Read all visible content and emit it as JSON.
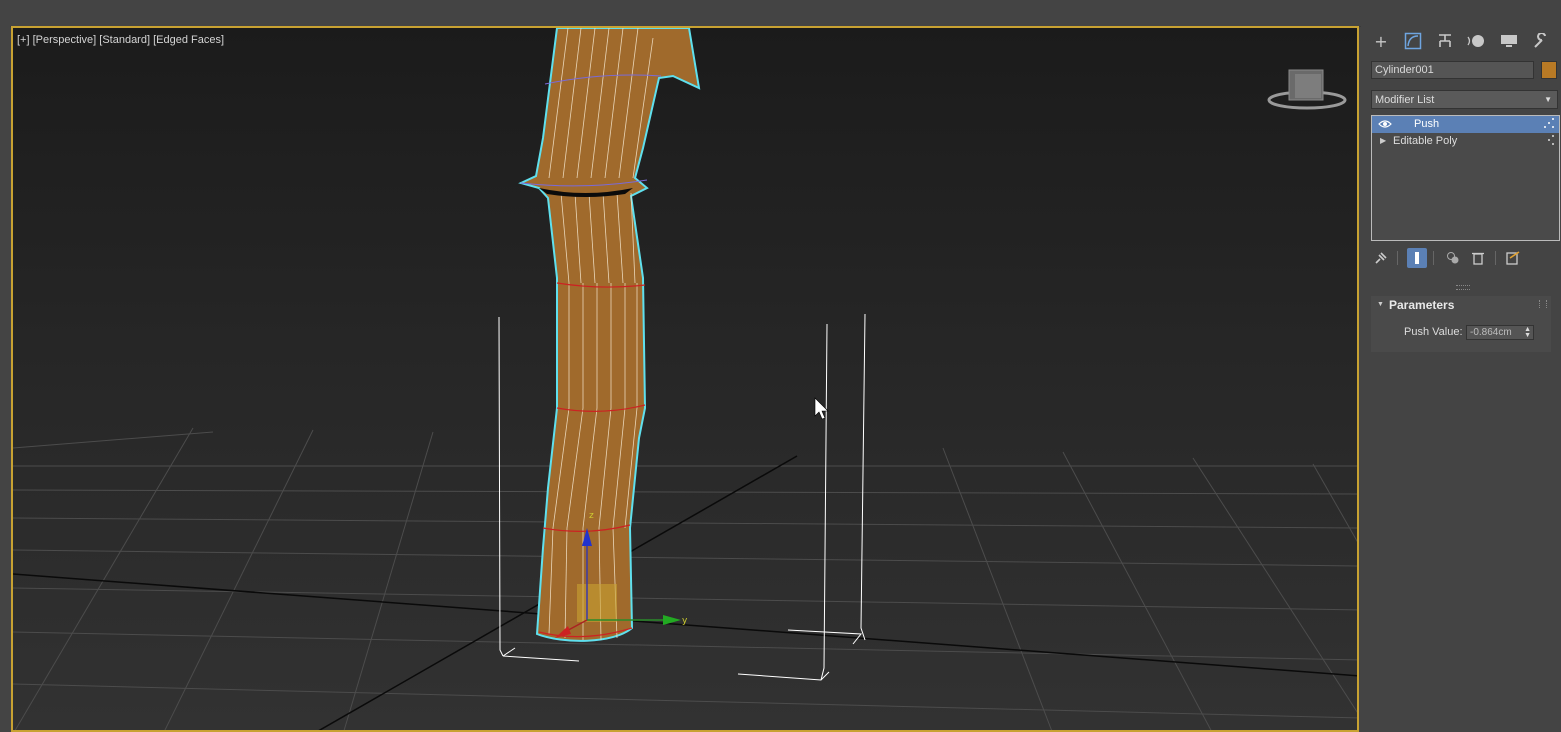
{
  "viewport": {
    "labels": [
      "[+]",
      "[Perspective]",
      "[Standard]",
      "[Edged Faces]"
    ],
    "gizmo_axes": {
      "x": "x",
      "y": "y",
      "z": "z"
    }
  },
  "command_panel": {
    "tabs": [
      {
        "name": "create-tab",
        "icon": "plus-icon"
      },
      {
        "name": "modify-tab",
        "icon": "modify-curve-icon",
        "active": true
      },
      {
        "name": "hierarchy-tab",
        "icon": "hierarchy-icon"
      },
      {
        "name": "motion-tab",
        "icon": "motion-icon"
      },
      {
        "name": "display-tab",
        "icon": "display-monitor-icon"
      },
      {
        "name": "utilities-tab",
        "icon": "wrench-icon"
      }
    ],
    "object_name": "Cylinder001",
    "object_color": "#b87a25",
    "modifier_list_label": "Modifier List",
    "stack": [
      {
        "label": "Push",
        "selected": true,
        "has_eye": true
      },
      {
        "label": "Editable Poly",
        "selected": false,
        "expandable": true
      }
    ],
    "rollout": {
      "title": "Parameters",
      "push_value_label": "Push Value:",
      "push_value": "-0.864cm"
    }
  },
  "colors": {
    "selection_highlight": "#5b80b5",
    "viewport_border": "#c8a232",
    "mesh_fill": "#a06a2c",
    "mesh_outline": "#5fe0ee"
  }
}
